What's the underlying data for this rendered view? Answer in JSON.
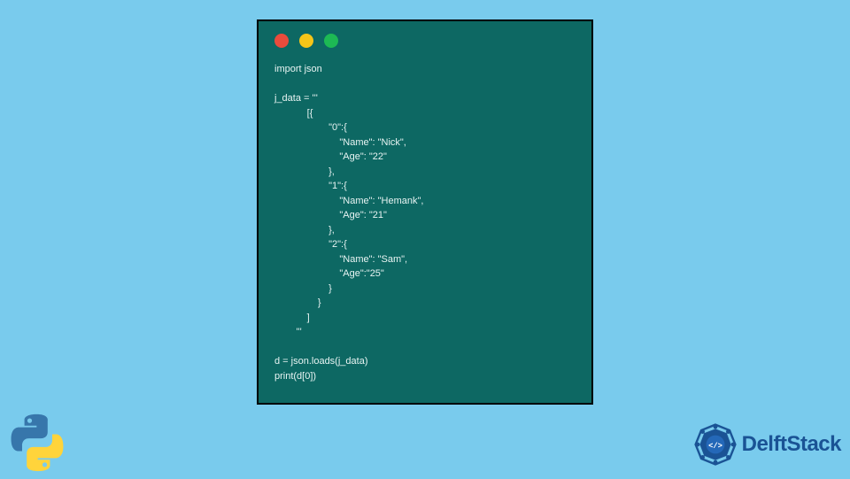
{
  "code_window": {
    "content": "import json\n\nj_data = '''\n            [{\n                    \"0\":{\n                        \"Name\": \"Nick\",\n                        \"Age\": \"22\"\n                    },\n                    \"1\":{\n                        \"Name\": \"Hemank\",\n                        \"Age\": \"21\"\n                    },\n                    \"2\":{\n                        \"Name\": \"Sam\",\n                        \"Age\":\"25\"\n                    }\n                }\n            ]\n        '''\n\nd = json.loads(j_data)\nprint(d[0])"
  },
  "branding": {
    "name": "DelftStack"
  }
}
